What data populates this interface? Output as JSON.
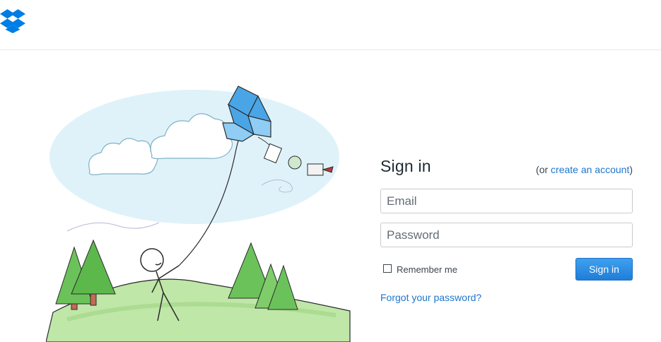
{
  "icons": {
    "logo": "dropbox-logo",
    "illustration": "stick-figure-flying-dropbox-kite"
  },
  "signin": {
    "title": "Sign in",
    "alt_prefix": "(or ",
    "alt_link": "create an account",
    "alt_suffix": ")",
    "email_placeholder": "Email",
    "email_value": "",
    "password_placeholder": "Password",
    "password_value": "",
    "remember_label": "Remember me",
    "remember_checked": false,
    "submit_label": "Sign in",
    "forgot_label": "Forgot your password?"
  },
  "colors": {
    "brand_blue": "#007ee5",
    "link": "#1f75cc",
    "button_top": "#3fa0ee",
    "button_bottom": "#1f7dd8"
  }
}
